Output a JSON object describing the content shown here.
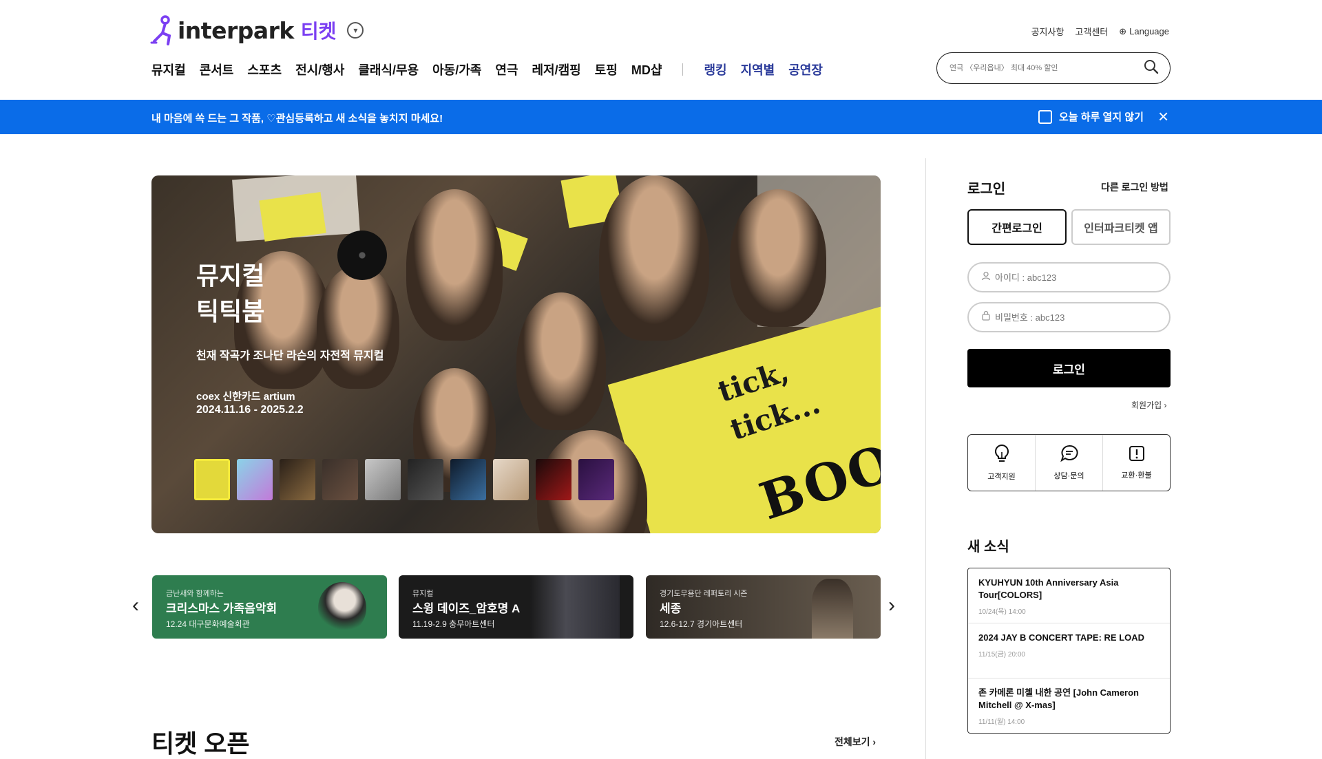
{
  "header": {
    "brand": "interpark",
    "brand_sub": "티켓",
    "util_links": [
      "공지사항",
      "고객센터"
    ],
    "language": "Language",
    "search_placeholder": "연극 〈우리읍내〉 최대 40% 할인"
  },
  "nav": {
    "categories": [
      "뮤지컬",
      "콘서트",
      "스포츠",
      "전시/행사",
      "클래식/무용",
      "아동/가족",
      "연극",
      "레저/캠핑",
      "토핑",
      "MD샵"
    ],
    "extras": [
      "랭킹",
      "지역별",
      "공연장"
    ]
  },
  "notice": {
    "message": "내 마음에 쏙 드는 그 작품, ♡관심등록하고 새 소식을 놓치지 마세요!",
    "dismiss_label": "오늘 하루 열지 않기"
  },
  "hero": {
    "title_line1": "뮤지컬",
    "title_line2": "틱틱붐",
    "subtitle": "천재 작곡가 조나단 라슨의 자전적 뮤지컬",
    "venue": "coex 신한카드 artium",
    "dates": "2024.11.16 - 2025.2.2",
    "art_text_1": "tick,",
    "art_text_2": "tick...",
    "art_text_3": "BOOM"
  },
  "promos": [
    {
      "category": "금난새와 함께하는",
      "title": "크리스마스 가족음악회",
      "info": "12.24 대구문화예술회관",
      "color": "#2e7d4f"
    },
    {
      "category": "뮤지컬",
      "title": "스윙 데이즈_암호명 A",
      "info": "11.19-2.9 충무아트센터",
      "color": "#1b1b1b"
    },
    {
      "category": "경기도무용단 레퍼토리 시즌",
      "title": "세종",
      "info": "12.6-12.7 경기아트센터",
      "color": "#3d3731"
    }
  ],
  "ticket_open": {
    "title": "티켓 오픈",
    "view_all": "전체보기"
  },
  "login": {
    "title": "로그인",
    "other_methods": "다른 로그인 방법",
    "easy_login": "간편로그인",
    "app_login": "인터파크티켓 앱",
    "id_placeholder": "아이디 : abc123",
    "pw_placeholder": "비밀번호 : abc123",
    "submit": "로그인",
    "signup": "회원가입"
  },
  "help": {
    "items": [
      "고객지원",
      "상담·문의",
      "교환·환불"
    ]
  },
  "news": {
    "title": "새 소식",
    "items": [
      {
        "title": "KYUHYUN 10th Anniversary Asia Tour[COLORS]",
        "date": "10/24(목) 14:00"
      },
      {
        "title": "2024 JAY B CONCERT TAPE: RE LOAD",
        "date": "11/15(금) 20:00"
      },
      {
        "title": "존 카메론 미첼 내한 공연 [John Cameron Mitchell @ X-mas]",
        "date": "11/11(월) 14:00"
      }
    ]
  },
  "colors": {
    "notice_bar": "#0a6ce8",
    "brand_purple": "#7b3ff2",
    "hero_yellow": "#e9e24a"
  }
}
